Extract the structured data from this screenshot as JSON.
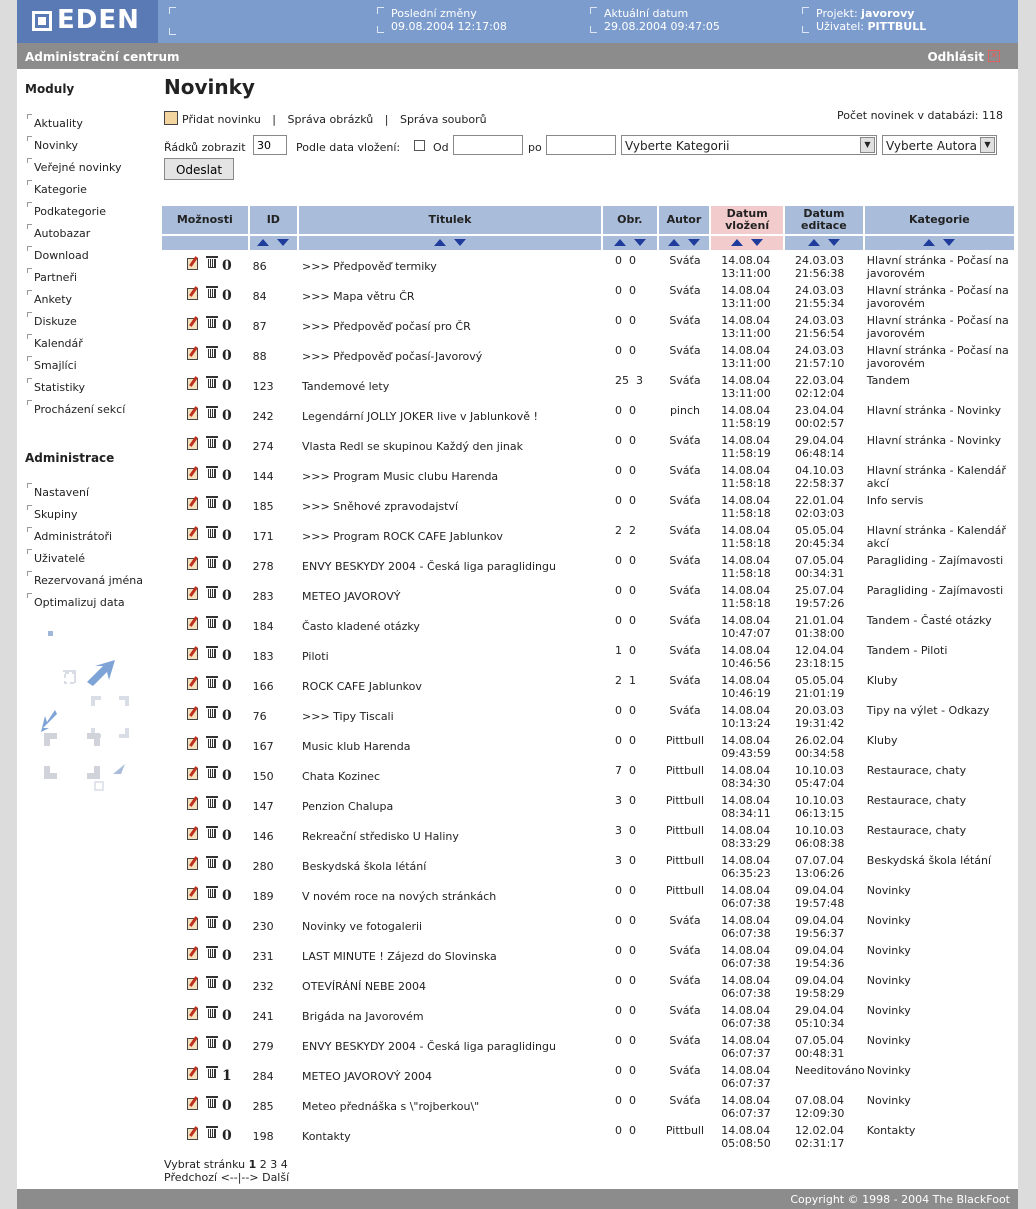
{
  "header": {
    "logo": "EDEN",
    "last_changes_label": "Poslední změny",
    "last_changes_value": "09.08.2004 12:17:08",
    "current_date_label": "Aktuální datum",
    "current_date_value": "29.08.2004 09:47:05",
    "project_label": "Projekt:",
    "project_value": "javorovy",
    "user_label": "Uživatel:",
    "user_value": "PITTBULL"
  },
  "subbar": {
    "title": "Administrační centrum",
    "logout": "Odhlásit"
  },
  "sidebar": {
    "modules_heading": "Moduly",
    "modules": [
      "Aktuality",
      "Novinky",
      "Veřejné novinky",
      "Kategorie",
      "Podkategorie",
      "Autobazar",
      "Download",
      "Partneři",
      "Ankety",
      "Diskuze",
      "Kalendář",
      "Smajlíci",
      "Statistiky",
      "Procházení sekcí"
    ],
    "admin_heading": "Administrace",
    "admin": [
      "Nastavení",
      "Skupiny",
      "Administrátoři",
      "Uživatelé",
      "Rezervovaná jména",
      "Optimalizuj data"
    ]
  },
  "main": {
    "title": "Novinky",
    "add_link": "Přidat novinku",
    "images_link": "Správa obrázků",
    "files_link": "Správa souborů",
    "separator": "|",
    "count_label": "Počet novinek v databázi: 118",
    "rows_label": "Řádků zobrazit",
    "rows_value": "30",
    "date_filter_label": "Podle data vložení:",
    "from_label": "Od",
    "to_label": "po",
    "category_select": "Vyberte Kategorii",
    "author_select": "Vyberte Autora",
    "submit": "Odeslat"
  },
  "table": {
    "headers": {
      "options": "Možnosti",
      "id": "ID",
      "title": "Titulek",
      "images": "Obr.",
      "author": "Autor",
      "inserted_1": "Datum",
      "inserted_2": "vložení",
      "edited_1": "Datum",
      "edited_2": "editace",
      "category": "Kategorie"
    },
    "rows": [
      {
        "c": "0",
        "id": "86",
        "title": ">>> Předpověď termiky",
        "obr": "0  0",
        "author": "Sváťa",
        "ins1": "14.08.04",
        "ins2": "13:11:00",
        "ed1": "24.03.03",
        "ed2": "21:56:38",
        "cat": "Hlavní stránka - Počasí na javorovém"
      },
      {
        "c": "0",
        "id": "84",
        "title": ">>> Mapa větru ČR",
        "obr": "0  0",
        "author": "Sváťa",
        "ins1": "14.08.04",
        "ins2": "13:11:00",
        "ed1": "24.03.03",
        "ed2": "21:55:34",
        "cat": "Hlavní stránka - Počasí na javorovém"
      },
      {
        "c": "0",
        "id": "87",
        "title": ">>> Předpověď počasí pro ČR",
        "obr": "0  0",
        "author": "Sváťa",
        "ins1": "14.08.04",
        "ins2": "13:11:00",
        "ed1": "24.03.03",
        "ed2": "21:56:54",
        "cat": "Hlavní stránka - Počasí na javorovém"
      },
      {
        "c": "0",
        "id": "88",
        "title": ">>> Předpověď počasí-Javorový",
        "obr": "0  0",
        "author": "Sváťa",
        "ins1": "14.08.04",
        "ins2": "13:11:00",
        "ed1": "24.03.03",
        "ed2": "21:57:10",
        "cat": "Hlavní stránka - Počasí na javorovém"
      },
      {
        "c": "0",
        "id": "123",
        "title": "Tandemové lety",
        "obr": "25  3",
        "author": "Sváťa",
        "ins1": "14.08.04",
        "ins2": "13:11:00",
        "ed1": "22.03.04",
        "ed2": "02:12:04",
        "cat": "Tandem"
      },
      {
        "c": "0",
        "id": "242",
        "title": "Legendární JOLLY JOKER live v Jablunkově !",
        "obr": "0  0",
        "author": "pinch",
        "ins1": "14.08.04",
        "ins2": "11:58:19",
        "ed1": "23.04.04",
        "ed2": "00:02:57",
        "cat": "Hlavní stránka - Novinky"
      },
      {
        "c": "0",
        "id": "274",
        "title": "Vlasta Redl se skupinou Každý den jinak",
        "obr": "0  0",
        "author": "Sváťa",
        "ins1": "14.08.04",
        "ins2": "11:58:19",
        "ed1": "29.04.04",
        "ed2": "06:48:14",
        "cat": "Hlavní stránka - Novinky"
      },
      {
        "c": "0",
        "id": "144",
        "title": ">>> Program Music clubu Harenda",
        "obr": "0  0",
        "author": "Sváťa",
        "ins1": "14.08.04",
        "ins2": "11:58:18",
        "ed1": "04.10.03",
        "ed2": "22:58:37",
        "cat": "Hlavní stránka - Kalendář akcí"
      },
      {
        "c": "0",
        "id": "185",
        "title": ">>> Sněhové zpravodajství",
        "obr": "0  0",
        "author": "Sváťa",
        "ins1": "14.08.04",
        "ins2": "11:58:18",
        "ed1": "22.01.04",
        "ed2": "02:03:03",
        "cat": "Info servis"
      },
      {
        "c": "0",
        "id": "171",
        "title": ">>> Program ROCK CAFE Jablunkov",
        "obr": "2  2",
        "author": "Sváťa",
        "ins1": "14.08.04",
        "ins2": "11:58:18",
        "ed1": "05.05.04",
        "ed2": "20:45:34",
        "cat": "Hlavní stránka - Kalendář akcí"
      },
      {
        "c": "0",
        "id": "278",
        "title": "ENVY BESKYDY 2004 - Česká liga paraglidingu",
        "obr": "0  0",
        "author": "Sváťa",
        "ins1": "14.08.04",
        "ins2": "11:58:18",
        "ed1": "07.05.04",
        "ed2": "00:34:31",
        "cat": "Paragliding - Zajímavosti"
      },
      {
        "c": "0",
        "id": "283",
        "title": "METEO JAVOROVÝ",
        "obr": "0  0",
        "author": "Sváťa",
        "ins1": "14.08.04",
        "ins2": "11:58:18",
        "ed1": "25.07.04",
        "ed2": "19:57:26",
        "cat": "Paragliding - Zajímavosti"
      },
      {
        "c": "0",
        "id": "184",
        "title": "Často kladené otázky",
        "obr": "0  0",
        "author": "Sváťa",
        "ins1": "14.08.04",
        "ins2": "10:47:07",
        "ed1": "21.01.04",
        "ed2": "01:38:00",
        "cat": "Tandem - Časté otázky"
      },
      {
        "c": "0",
        "id": "183",
        "title": "Piloti",
        "obr": "1  0",
        "author": "Sváťa",
        "ins1": "14.08.04",
        "ins2": "10:46:56",
        "ed1": "12.04.04",
        "ed2": "23:18:15",
        "cat": "Tandem - Piloti"
      },
      {
        "c": "0",
        "id": "166",
        "title": "ROCK CAFE Jablunkov",
        "obr": "2  1",
        "author": "Sváťa",
        "ins1": "14.08.04",
        "ins2": "10:46:19",
        "ed1": "05.05.04",
        "ed2": "21:01:19",
        "cat": "Kluby"
      },
      {
        "c": "0",
        "id": "76",
        "title": ">>> Tipy Tiscali",
        "obr": "0  0",
        "author": "Sváťa",
        "ins1": "14.08.04",
        "ins2": "10:13:24",
        "ed1": "20.03.03",
        "ed2": "19:31:42",
        "cat": "Tipy na výlet - Odkazy"
      },
      {
        "c": "0",
        "id": "167",
        "title": "Music klub Harenda",
        "obr": "0  0",
        "author": "Pittbull",
        "ins1": "14.08.04",
        "ins2": "09:43:59",
        "ed1": "26.02.04",
        "ed2": "00:34:58",
        "cat": "Kluby"
      },
      {
        "c": "0",
        "id": "150",
        "title": "Chata Kozinec",
        "obr": "7  0",
        "author": "Pittbull",
        "ins1": "14.08.04",
        "ins2": "08:34:30",
        "ed1": "10.10.03",
        "ed2": "05:47:04",
        "cat": "Restaurace, chaty"
      },
      {
        "c": "0",
        "id": "147",
        "title": "Penzion Chalupa",
        "obr": "3  0",
        "author": "Pittbull",
        "ins1": "14.08.04",
        "ins2": "08:34:11",
        "ed1": "10.10.03",
        "ed2": "06:13:15",
        "cat": "Restaurace, chaty"
      },
      {
        "c": "0",
        "id": "146",
        "title": "Rekreační středisko U Haliny",
        "obr": "3  0",
        "author": "Pittbull",
        "ins1": "14.08.04",
        "ins2": "08:33:29",
        "ed1": "10.10.03",
        "ed2": "06:08:38",
        "cat": "Restaurace, chaty"
      },
      {
        "c": "0",
        "id": "280",
        "title": "Beskydská škola létání",
        "obr": "3  0",
        "author": "Pittbull",
        "ins1": "14.08.04",
        "ins2": "06:35:23",
        "ed1": "07.07.04",
        "ed2": "13:06:26",
        "cat": "Beskydská škola létání"
      },
      {
        "c": "0",
        "id": "189",
        "title": "V novém roce na nových stránkách",
        "obr": "0  0",
        "author": "Pittbull",
        "ins1": "14.08.04",
        "ins2": "06:07:38",
        "ed1": "09.04.04",
        "ed2": "19:57:48",
        "cat": "Novinky"
      },
      {
        "c": "0",
        "id": "230",
        "title": "Novinky ve fotogalerii",
        "obr": "0  0",
        "author": "Sváťa",
        "ins1": "14.08.04",
        "ins2": "06:07:38",
        "ed1": "09.04.04",
        "ed2": "19:56:37",
        "cat": "Novinky"
      },
      {
        "c": "0",
        "id": "231",
        "title": "LAST MINUTE ! Zájezd do Slovinska",
        "obr": "0  0",
        "author": "Sváťa",
        "ins1": "14.08.04",
        "ins2": "06:07:38",
        "ed1": "09.04.04",
        "ed2": "19:54:36",
        "cat": "Novinky"
      },
      {
        "c": "0",
        "id": "232",
        "title": "OTEVÍRÁNÍ NEBE 2004",
        "obr": "0  0",
        "author": "Sváťa",
        "ins1": "14.08.04",
        "ins2": "06:07:38",
        "ed1": "09.04.04",
        "ed2": "19:58:29",
        "cat": "Novinky"
      },
      {
        "c": "0",
        "id": "241",
        "title": "Brigáda na Javorovém",
        "obr": "0  0",
        "author": "Sváťa",
        "ins1": "14.08.04",
        "ins2": "06:07:38",
        "ed1": "29.04.04",
        "ed2": "05:10:34",
        "cat": "Novinky"
      },
      {
        "c": "0",
        "id": "279",
        "title": "ENVY BESKYDY 2004 - Česká liga paraglidingu",
        "obr": "0  0",
        "author": "Sváťa",
        "ins1": "14.08.04",
        "ins2": "06:07:37",
        "ed1": "07.05.04",
        "ed2": "00:48:31",
        "cat": "Novinky"
      },
      {
        "c": "1",
        "id": "284",
        "title": "METEO JAVOROVÝ 2004",
        "obr": "0  0",
        "author": "Sváťa",
        "ins1": "14.08.04",
        "ins2": "06:07:37",
        "ed1": "Needitováno",
        "ed2": "",
        "cat": "Novinky"
      },
      {
        "c": "0",
        "id": "285",
        "title": "Meteo přednáška s \\\"rojberkou\\\"",
        "obr": "0  0",
        "author": "Sváťa",
        "ins1": "14.08.04",
        "ins2": "06:07:37",
        "ed1": "07.08.04",
        "ed2": "12:09:30",
        "cat": "Novinky"
      },
      {
        "c": "0",
        "id": "198",
        "title": "Kontakty",
        "obr": "0  0",
        "author": "Pittbull",
        "ins1": "14.08.04",
        "ins2": "05:08:50",
        "ed1": "12.02.04",
        "ed2": "02:31:17",
        "cat": "Kontakty"
      }
    ]
  },
  "pager": {
    "label": "Vybrat stránku",
    "current": "1",
    "pages": [
      "2",
      "3",
      "4"
    ],
    "prev": "Předchozí",
    "middle": "<--|-->",
    "next": "Další"
  },
  "footer": {
    "copyright": "Copyright © 1998 - 2004 The BlackFoot"
  },
  "colors": {
    "header_bg": "#7c9ccd",
    "logo_bg": "#5a7ab5",
    "bar_gray": "#8c8c8c",
    "table_header": "#a9bddb",
    "highlight_header": "#f2cccc",
    "sort_arrow": "#1f3c9c"
  }
}
